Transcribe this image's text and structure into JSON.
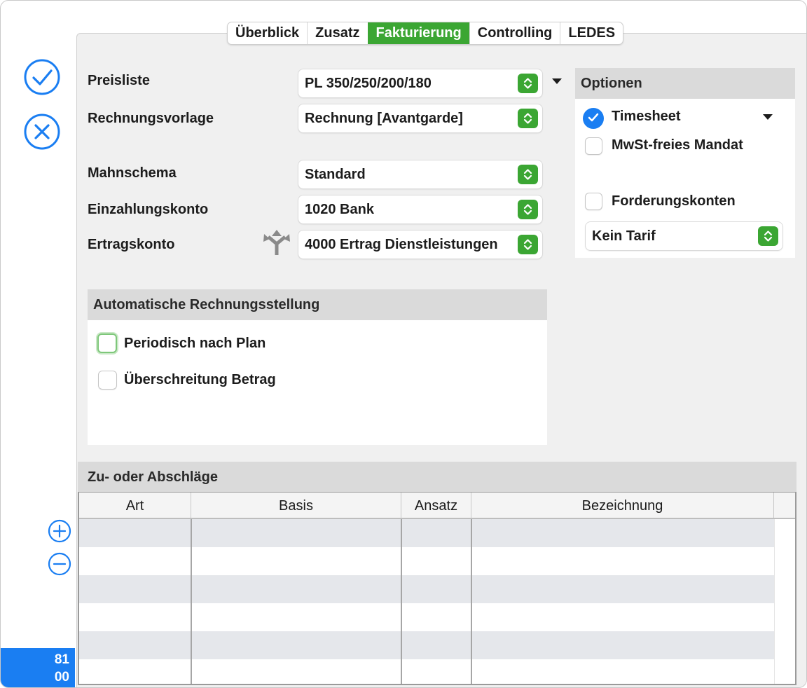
{
  "tabs": [
    {
      "label": "Überblick",
      "active": false
    },
    {
      "label": "Zusatz",
      "active": false
    },
    {
      "label": "Fakturierung",
      "active": true
    },
    {
      "label": "Controlling",
      "active": false
    },
    {
      "label": "LEDES",
      "active": false
    }
  ],
  "form": {
    "preisliste_label": "Preisliste",
    "preisliste_value": "PL 350/250/200/180",
    "rechnungsvorlage_label": "Rechnungsvorlage",
    "rechnungsvorlage_value": "Rechnung [Avantgarde]",
    "mahnschema_label": "Mahnschema",
    "mahnschema_value": "Standard",
    "einzahlungskonto_label": "Einzahlungskonto",
    "einzahlungskonto_value": "1020 Bank",
    "ertragskonto_label": "Ertragskonto",
    "ertragskonto_value": "4000 Ertrag Dienstleistungen"
  },
  "optionen": {
    "header": "Optionen",
    "timesheet_label": "Timesheet",
    "timesheet_checked": true,
    "mwst_label": "MwSt-freies Mandat",
    "mwst_checked": false,
    "forderungskonten_label": "Forderungskonten",
    "forderungskonten_checked": false,
    "tarif_value": "Kein Tarif"
  },
  "auto_billing": {
    "header": "Automatische Rechnungsstellung",
    "periodisch_label": "Periodisch nach Plan",
    "periodisch_checked": false,
    "ueberschreitung_label": "Überschreitung Betrag",
    "ueberschreitung_checked": false
  },
  "adjustments": {
    "header": "Zu- oder Abschläge",
    "columns": [
      "Art",
      "Basis",
      "Ansatz",
      "Bezeichnung"
    ],
    "rows": []
  },
  "badge": {
    "line1": "81",
    "line2": "00"
  },
  "icons": {
    "confirm": "checkmark-circle-icon",
    "cancel": "x-circle-icon",
    "add": "plus-circle-icon",
    "remove": "minus-circle-icon",
    "route": "split-arrows-icon",
    "accent_green": "#3ba633",
    "accent_blue": "#1a7ef2"
  }
}
